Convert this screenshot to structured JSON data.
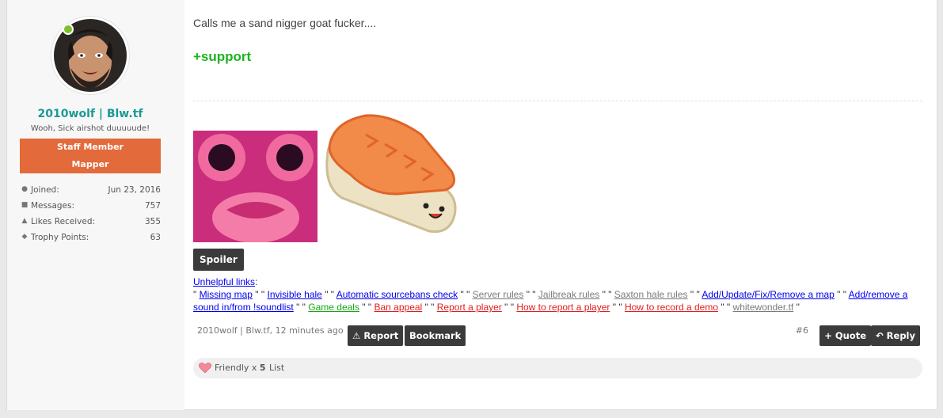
{
  "user": {
    "name": "2010wolf | Blw.tf",
    "title": "Wooh, Sick airshot duuuuude!",
    "banners": [
      "Staff Member",
      "Mapper"
    ],
    "stats": [
      {
        "icon": "user-icon",
        "label": "Joined:",
        "value": "Jun 23, 2016"
      },
      {
        "icon": "messages-icon",
        "label": "Messages:",
        "value": "757"
      },
      {
        "icon": "thumbs-up-icon",
        "label": "Likes Received:",
        "value": "355"
      },
      {
        "icon": "trophy-icon",
        "label": "Trophy Points:",
        "value": "63"
      }
    ]
  },
  "message": {
    "text": "Calls me a sand nigger goat fucker....",
    "support": "+support"
  },
  "signature": {
    "spoiler_label": "Spoiler",
    "links_label": "Unhelpful links",
    "links": [
      {
        "text": "Missing map",
        "color": "blue"
      },
      {
        "text": "Invisible hale",
        "color": "blue"
      },
      {
        "text": "Automatic sourcebans check",
        "color": "blue"
      },
      {
        "text": "Server rules",
        "color": "gray"
      },
      {
        "text": "Jailbreak rules",
        "color": "gray"
      },
      {
        "text": "Saxton hale rules",
        "color": "gray"
      },
      {
        "text": "Add/Update/Fix/Remove a map",
        "color": "blue"
      },
      {
        "text": "Add/remove a sound in/from !soundlist",
        "color": "blue"
      },
      {
        "text": "Game deals",
        "color": "green"
      },
      {
        "text": "Ban appeal",
        "color": "red"
      },
      {
        "text": "Report a player",
        "color": "red"
      },
      {
        "text": "How to report a player",
        "color": "red"
      },
      {
        "text": "How to record a demo",
        "color": "red"
      },
      {
        "text": "whitewonder.tf",
        "color": "gray"
      }
    ]
  },
  "footer": {
    "meta": "2010wolf | Blw.tf, 12 minutes ago",
    "report": "Report",
    "bookmark": "Bookmark",
    "post_number": "#6",
    "quote": "+ Quote",
    "reply": "Reply"
  },
  "likes": {
    "label": "Friendly x",
    "count": "5",
    "list": "List"
  },
  "colors": {
    "username": "#1c9a94",
    "banner": "#e26a3b",
    "support": "#1db31d",
    "button": "#3b3b3b"
  }
}
